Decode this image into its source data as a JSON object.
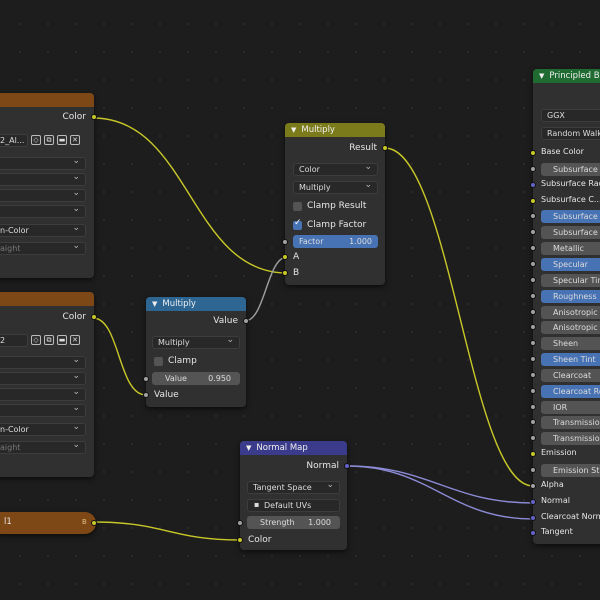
{
  "colors": {
    "tex_header": "#7e4716",
    "math_header": "#7b7b1c",
    "vmath_header": "#2d6593",
    "normalmap_header": "#3b3b8c",
    "bsdf_header": "#1f6b32",
    "socket_color": "#c7c729",
    "socket_float": "#a1a1a1",
    "socket_vector": "#6363c7",
    "wire_color": "#c7c729",
    "wire_vector": "#8b8bd6",
    "wire_float": "#9f9f9f",
    "accent": "#4772b3"
  },
  "tex1": {
    "output": "Color",
    "image_name": "2_Al...",
    "colorspace": "n-Color",
    "alpha": "aight"
  },
  "tex2": {
    "output": "Color",
    "image_name": "2",
    "colorspace": "n-Color",
    "alpha": "aight"
  },
  "orange_node": {
    "label": "l1"
  },
  "multiply_color": {
    "title": "Multiply",
    "output": "Result",
    "blend_type": "Color",
    "operation": "Multiply",
    "clamp_result": "Clamp Result",
    "clamp_factor": "Clamp Factor",
    "factor_label": "Factor",
    "factor_value": "1.000",
    "input_a": "A",
    "input_b": "B"
  },
  "multiply_value": {
    "title": "Multiply",
    "output": "Value",
    "operation": "Multiply",
    "clamp": "Clamp",
    "value_label": "Value",
    "value_value": "0.950",
    "input": "Value"
  },
  "normal_map": {
    "title": "Normal Map",
    "output": "Normal",
    "space": "Tangent Space",
    "uv": "Default UVs",
    "strength_label": "Strength",
    "strength_value": "1.000",
    "input": "Color"
  },
  "bsdf": {
    "title": "Principled BSDF",
    "distribution": "GGX",
    "subsurface_method": "Random Walk",
    "rows": [
      {
        "label": "Base Color",
        "kind": "socket"
      },
      {
        "label": "Subsurface",
        "kind": "btn"
      },
      {
        "label": "Subsurface Radius",
        "kind": "socket"
      },
      {
        "label": "Subsurface C...",
        "kind": "socket"
      },
      {
        "label": "Subsurface IOR",
        "kind": "sel"
      },
      {
        "label": "Subsurface Anisotropy",
        "kind": "btn"
      },
      {
        "label": "Metallic",
        "kind": "btn"
      },
      {
        "label": "Specular",
        "kind": "sel"
      },
      {
        "label": "Specular Tint",
        "kind": "btn"
      },
      {
        "label": "Roughness",
        "kind": "sel"
      },
      {
        "label": "Anisotropic",
        "kind": "btn"
      },
      {
        "label": "Anisotropic Rotation",
        "kind": "btn"
      },
      {
        "label": "Sheen",
        "kind": "btn"
      },
      {
        "label": "Sheen Tint",
        "kind": "sel"
      },
      {
        "label": "Clearcoat",
        "kind": "btn"
      },
      {
        "label": "Clearcoat Roughness",
        "kind": "sel"
      },
      {
        "label": "IOR",
        "kind": "btn"
      },
      {
        "label": "Transmission",
        "kind": "btn"
      },
      {
        "label": "Transmission Roughness",
        "kind": "btn"
      },
      {
        "label": "Emission",
        "kind": "socket"
      },
      {
        "label": "Emission Strength",
        "kind": "btn"
      },
      {
        "label": "Alpha",
        "kind": "socket"
      },
      {
        "label": "Normal",
        "kind": "socket"
      },
      {
        "label": "Clearcoat Normal",
        "kind": "socket"
      },
      {
        "label": "Tangent",
        "kind": "socket"
      }
    ]
  }
}
